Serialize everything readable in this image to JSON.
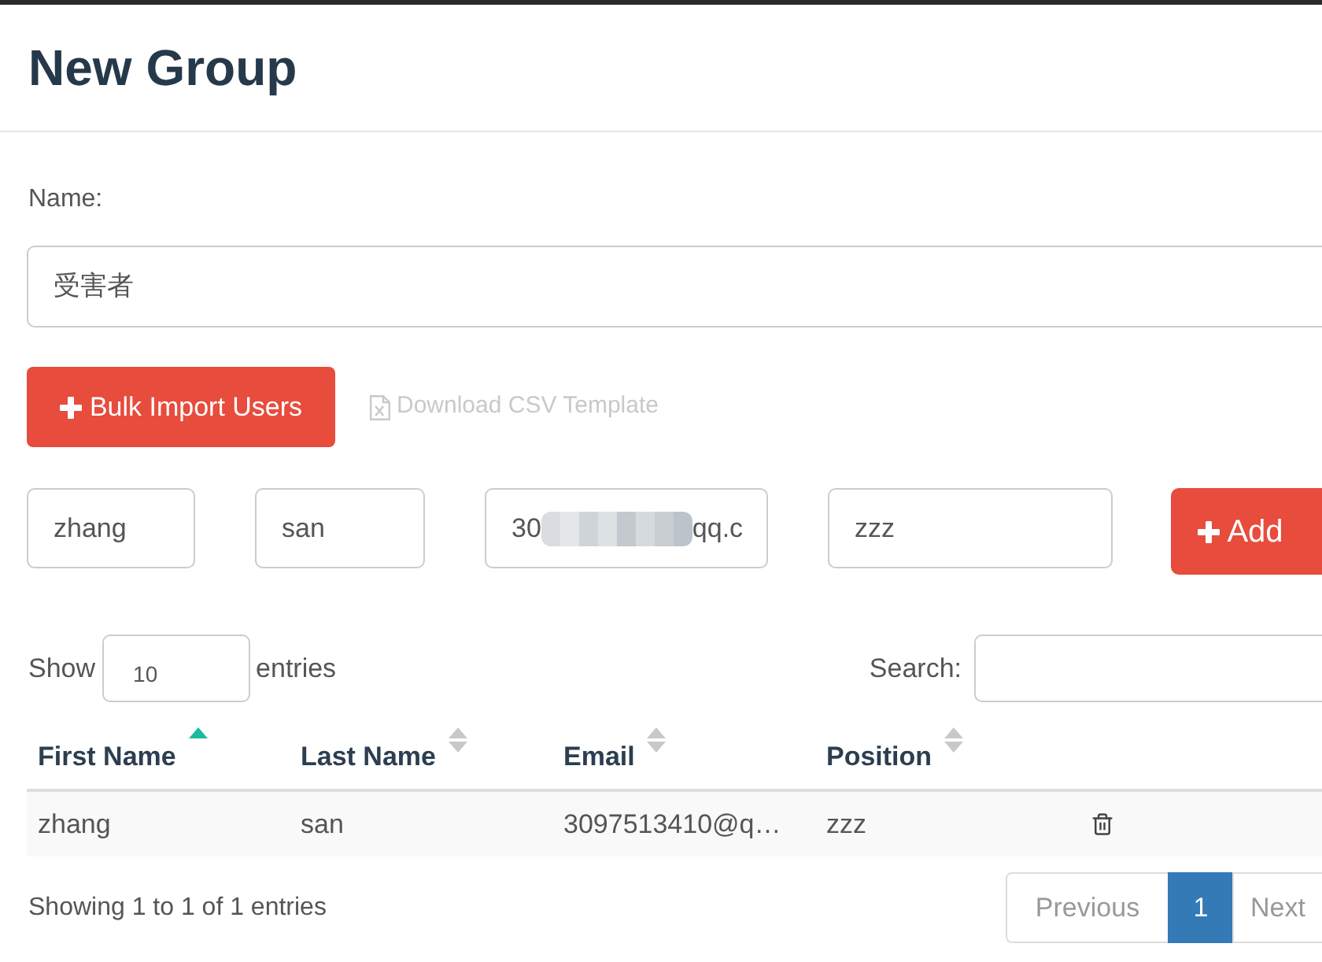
{
  "header": {
    "title": "New Group"
  },
  "name_field": {
    "label": "Name:",
    "value": "受害者"
  },
  "actions": [
    {
      "kind": "button",
      "label": "Bulk Import Users",
      "disabled": false
    },
    {
      "kind": "link",
      "label": "Download CSV Template",
      "disabled": true
    }
  ],
  "new_user": {
    "fields": [
      {
        "kind": "text",
        "value": "zhang"
      },
      {
        "kind": "text",
        "value": "san"
      },
      {
        "kind": "redacted",
        "value_start": "30",
        "value_end": "qq.c"
      },
      {
        "kind": "text",
        "value": "zzz"
      }
    ],
    "add_button": {
      "label": "Add"
    }
  },
  "table_controls": {
    "show_label": "Show",
    "page_size": "10",
    "entries_label": "entries",
    "search_label": "Search:"
  },
  "table": {
    "columns": [
      {
        "label": "First Name",
        "sorted_ascending": true
      },
      {
        "label": "Last Name",
        "sorted_ascending": false
      },
      {
        "label": "Email",
        "sorted_ascending": false
      },
      {
        "label": "Position",
        "sorted_ascending": false
      }
    ],
    "rows": [
      {
        "cells": [
          "zhang",
          "san",
          "3097513410@q…",
          "zzz"
        ]
      }
    ]
  },
  "footer": {
    "info": "Showing 1 to 1 of 1 entries",
    "pagination": [
      {
        "kind": "previous",
        "label": "Previous",
        "selected": false,
        "disabled": true
      },
      {
        "kind": "page",
        "label": "1",
        "selected": true,
        "disabled": false
      },
      {
        "kind": "next",
        "label": "Next",
        "selected": false,
        "disabled": true
      }
    ]
  }
}
